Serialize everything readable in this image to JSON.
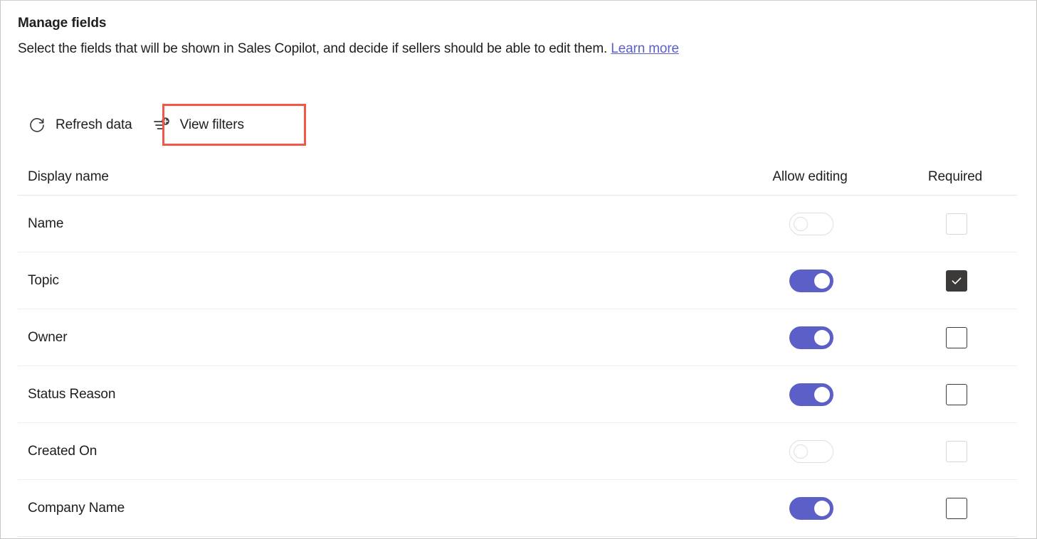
{
  "header": {
    "title": "Manage fields",
    "description_before_link": "Select the fields that will be shown in Sales Copilot, and decide if sellers should be able to edit them.",
    "link_label": "Learn more"
  },
  "toolbar": {
    "refresh_label": "Refresh data",
    "refresh_icon": "refresh-icon",
    "view_filters_label": "View filters",
    "view_filters_icon": "add-filter-icon",
    "highlight_color": "#f1574b"
  },
  "table": {
    "columns": {
      "display_name": "Display name",
      "allow_editing": "Allow editing",
      "required": "Required"
    },
    "rows": [
      {
        "name": "Name",
        "allow_editing": false,
        "allow_editing_disabled": true,
        "required": false,
        "required_disabled": true
      },
      {
        "name": "Topic",
        "allow_editing": true,
        "allow_editing_disabled": false,
        "required": true,
        "required_disabled": false
      },
      {
        "name": "Owner",
        "allow_editing": true,
        "allow_editing_disabled": false,
        "required": false,
        "required_disabled": false
      },
      {
        "name": "Status Reason",
        "allow_editing": true,
        "allow_editing_disabled": false,
        "required": false,
        "required_disabled": false
      },
      {
        "name": "Created On",
        "allow_editing": false,
        "allow_editing_disabled": true,
        "required": false,
        "required_disabled": true
      },
      {
        "name": "Company Name",
        "allow_editing": true,
        "allow_editing_disabled": false,
        "required": false,
        "required_disabled": false
      }
    ]
  },
  "colors": {
    "accent": "#5b5fc7",
    "link": "#5b5fc7",
    "checkbox_checked": "#3b3a39",
    "text": "#1f1e1d",
    "divider": "#ededed"
  }
}
